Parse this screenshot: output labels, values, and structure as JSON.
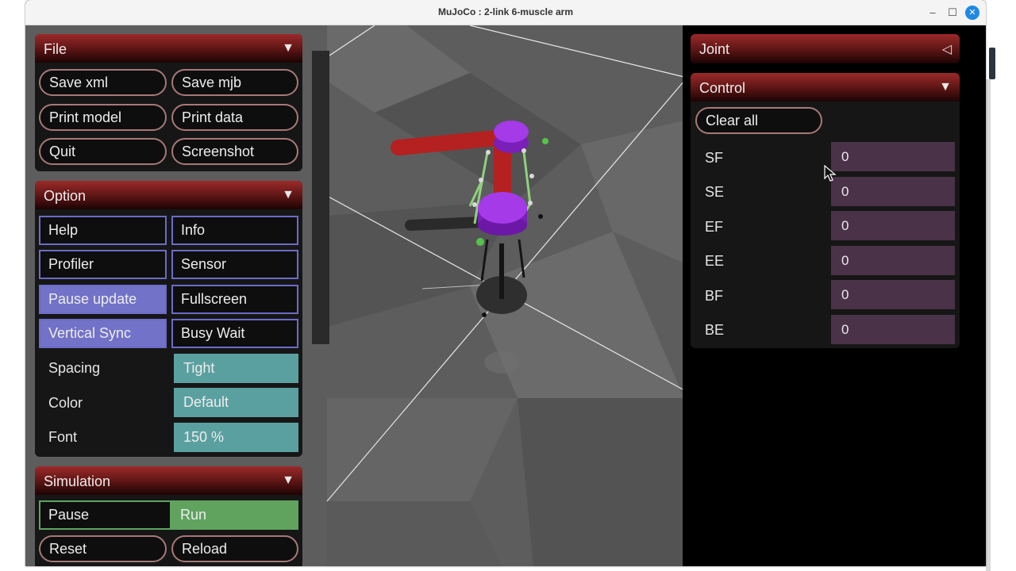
{
  "window": {
    "title": "MuJoCo : 2-link 6-muscle arm",
    "controls": [
      "–",
      "☐",
      "✕"
    ]
  },
  "file_panel": {
    "title": "File",
    "arrow": "▼",
    "buttons": [
      "Save xml",
      "Save mjb",
      "Print model",
      "Print data",
      "Quit",
      "Screenshot"
    ]
  },
  "option_panel": {
    "title": "Option",
    "arrow": "▼",
    "toggles": [
      {
        "label": "Help",
        "on": false
      },
      {
        "label": "Info",
        "on": false
      },
      {
        "label": "Profiler",
        "on": false
      },
      {
        "label": "Sensor",
        "on": false
      },
      {
        "label": "Pause update",
        "on": true
      },
      {
        "label": "Fullscreen",
        "on": false
      },
      {
        "label": "Vertical Sync",
        "on": true
      },
      {
        "label": "Busy Wait",
        "on": false
      }
    ],
    "spacing": {
      "label": "Spacing",
      "value": "Tight"
    },
    "color": {
      "label": "Color",
      "value": "Default"
    },
    "font": {
      "label": "Font",
      "value": "150 %"
    }
  },
  "simulation_panel": {
    "title": "Simulation",
    "arrow": "▼",
    "pause_label": "Pause",
    "run_label": "Run",
    "reset_label": "Reset",
    "reload_label": "Reload"
  },
  "joint_panel": {
    "title": "Joint",
    "arrow": "◁"
  },
  "control_panel": {
    "title": "Control",
    "arrow": "▼",
    "clear_label": "Clear all",
    "rows": [
      {
        "label": "SF",
        "value": "0"
      },
      {
        "label": "SE",
        "value": "0"
      },
      {
        "label": "EF",
        "value": "0"
      },
      {
        "label": "EE",
        "value": "0"
      },
      {
        "label": "BF",
        "value": "0"
      },
      {
        "label": "BE",
        "value": "0"
      }
    ]
  },
  "colors": {
    "header_red": "#9c2a2a",
    "toggle_on": "#7272c8",
    "select_teal": "#5ba0a0",
    "run_green": "#5fa35f",
    "control_field": "#4a3248",
    "limb_red": "#b52020",
    "joint_purple": "#9a2ee0",
    "muscle_green": "#7ccf6c"
  }
}
